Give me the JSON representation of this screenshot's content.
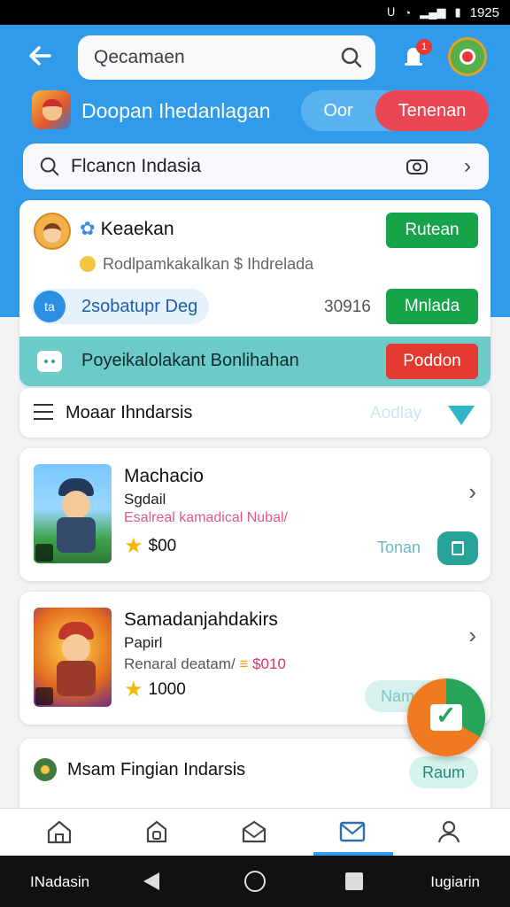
{
  "status_bar": {
    "time": "1925",
    "icons": [
      "vibrate-icon",
      "wifi-icon",
      "signal-icon",
      "battery-icon"
    ]
  },
  "header": {
    "search_value": "Qecamaen",
    "notification_count": "1"
  },
  "user": {
    "name": "Doopan Ihedanlagan",
    "toggle_off": "Oor",
    "toggle_on": "Tenenan"
  },
  "search_bar": {
    "value": "Flcancn Indasia"
  },
  "feature_card": {
    "title": "Keaekan",
    "subtitle": "Rodlpamkakalkan $ Ihdrelada",
    "button1": "Rutean",
    "row2_icon": "ta",
    "row2_label": "2sobatupr Deg",
    "row2_count": "30916",
    "button2": "Mnlada",
    "row3_label": "Poyeikalolakant Bonlihahan",
    "button3": "Poddon"
  },
  "filter_row": {
    "label": "Moaar Ihndarsis",
    "ghost": "Aodlay"
  },
  "games": [
    {
      "title": "Machacio",
      "sub": "Sgdail",
      "desc": "Esalreal kamadical Nubal/",
      "rating": "$00",
      "ghost": "Tonan"
    },
    {
      "title": "Samadanjahdakirs",
      "sub": "Papirl",
      "desc": "Renaral deatam/",
      "desc_price": "$010",
      "rating": "1000",
      "ghost": "Nam"
    }
  ],
  "bottom_card": {
    "label": "Msam Fingian Indarsis",
    "pill": "Raum"
  },
  "bottom_nav": {
    "active_index": 3
  },
  "system_nav": {
    "left": "INadasin",
    "right": "Iugiarin"
  },
  "colors": {
    "primary": "#2f9bea",
    "green": "#17a34a",
    "red": "#e23a30",
    "teal": "#6ccbc9"
  }
}
